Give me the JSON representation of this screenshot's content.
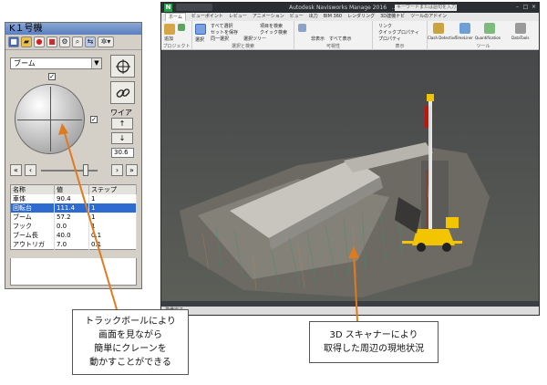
{
  "panel": {
    "title": "K１号機",
    "toolbar": [
      "save-icon",
      "open-icon",
      "record-icon",
      "stop-icon",
      "settings-icon",
      "zoom-icon",
      "link-icon",
      "gear-icon"
    ],
    "mode_value": "ブーム",
    "wire_label": "ワイア",
    "wire_up": "↑",
    "wire_down": "↓",
    "wire_value": "30.6",
    "nav": {
      "first": "«",
      "prev": "‹",
      "next": "›",
      "last": "»"
    },
    "table": {
      "headers": [
        "名称",
        "値",
        "ステップ"
      ],
      "rows": [
        {
          "name": "車体",
          "value": "90.4",
          "step": "1"
        },
        {
          "name": "回転台",
          "value": "111.4",
          "step": "1"
        },
        {
          "name": "ブーム",
          "value": "57.2",
          "step": "1"
        },
        {
          "name": "フック",
          "value": "0.0",
          "step": "1"
        },
        {
          "name": "ブーム長",
          "value": "40.0",
          "step": "0.1"
        },
        {
          "name": "アウトリガ",
          "value": "7.0",
          "step": "0.1"
        }
      ],
      "selected_row": 1
    }
  },
  "navisworks": {
    "logo": "N",
    "title": "Autodesk Navisworks Manage 2016      ...",
    "search_placeholder": "キーワードまたは語句を入力",
    "tabs": [
      "ホーム",
      "ビューポイント",
      "レビュー",
      "アニメーション",
      "ビュー",
      "出力",
      "BIM 360",
      "レンダリング",
      "3D建機ナビ",
      "ツールのアドイン"
    ],
    "active_tab": 0,
    "ribbon": {
      "groups": [
        {
          "caption": "プロジェクト"
        },
        {
          "caption": "選択と検索"
        },
        {
          "caption": "可視性"
        },
        {
          "caption": "表示"
        },
        {
          "caption": "ツール"
        }
      ],
      "items": [
        "追加",
        "リフレッシュ",
        "選択",
        "すべて選択",
        "セットを保存",
        "同一選択",
        "選択ツリー",
        "項目を検索",
        "クイック検索",
        "非表示",
        "すべて表示",
        "リンク",
        "クイックプロパティ",
        "プロパティ",
        "Clash Detective",
        "TimeLiner",
        "Quantification",
        "DataTools"
      ]
    },
    "status": "準備完了"
  },
  "callouts": {
    "left": [
      "トラックボールにより",
      "画面を見ながら",
      "簡単にクレーンを",
      "動かすことができる"
    ],
    "right": [
      "3D スキャナーにより",
      "取得した周辺の現地状況"
    ]
  },
  "colors": {
    "callout_arrow": "#e07a1f",
    "selection": "#2e6bd0",
    "crane_yellow": "#f2c500",
    "viewport_bg": "#50524e"
  }
}
